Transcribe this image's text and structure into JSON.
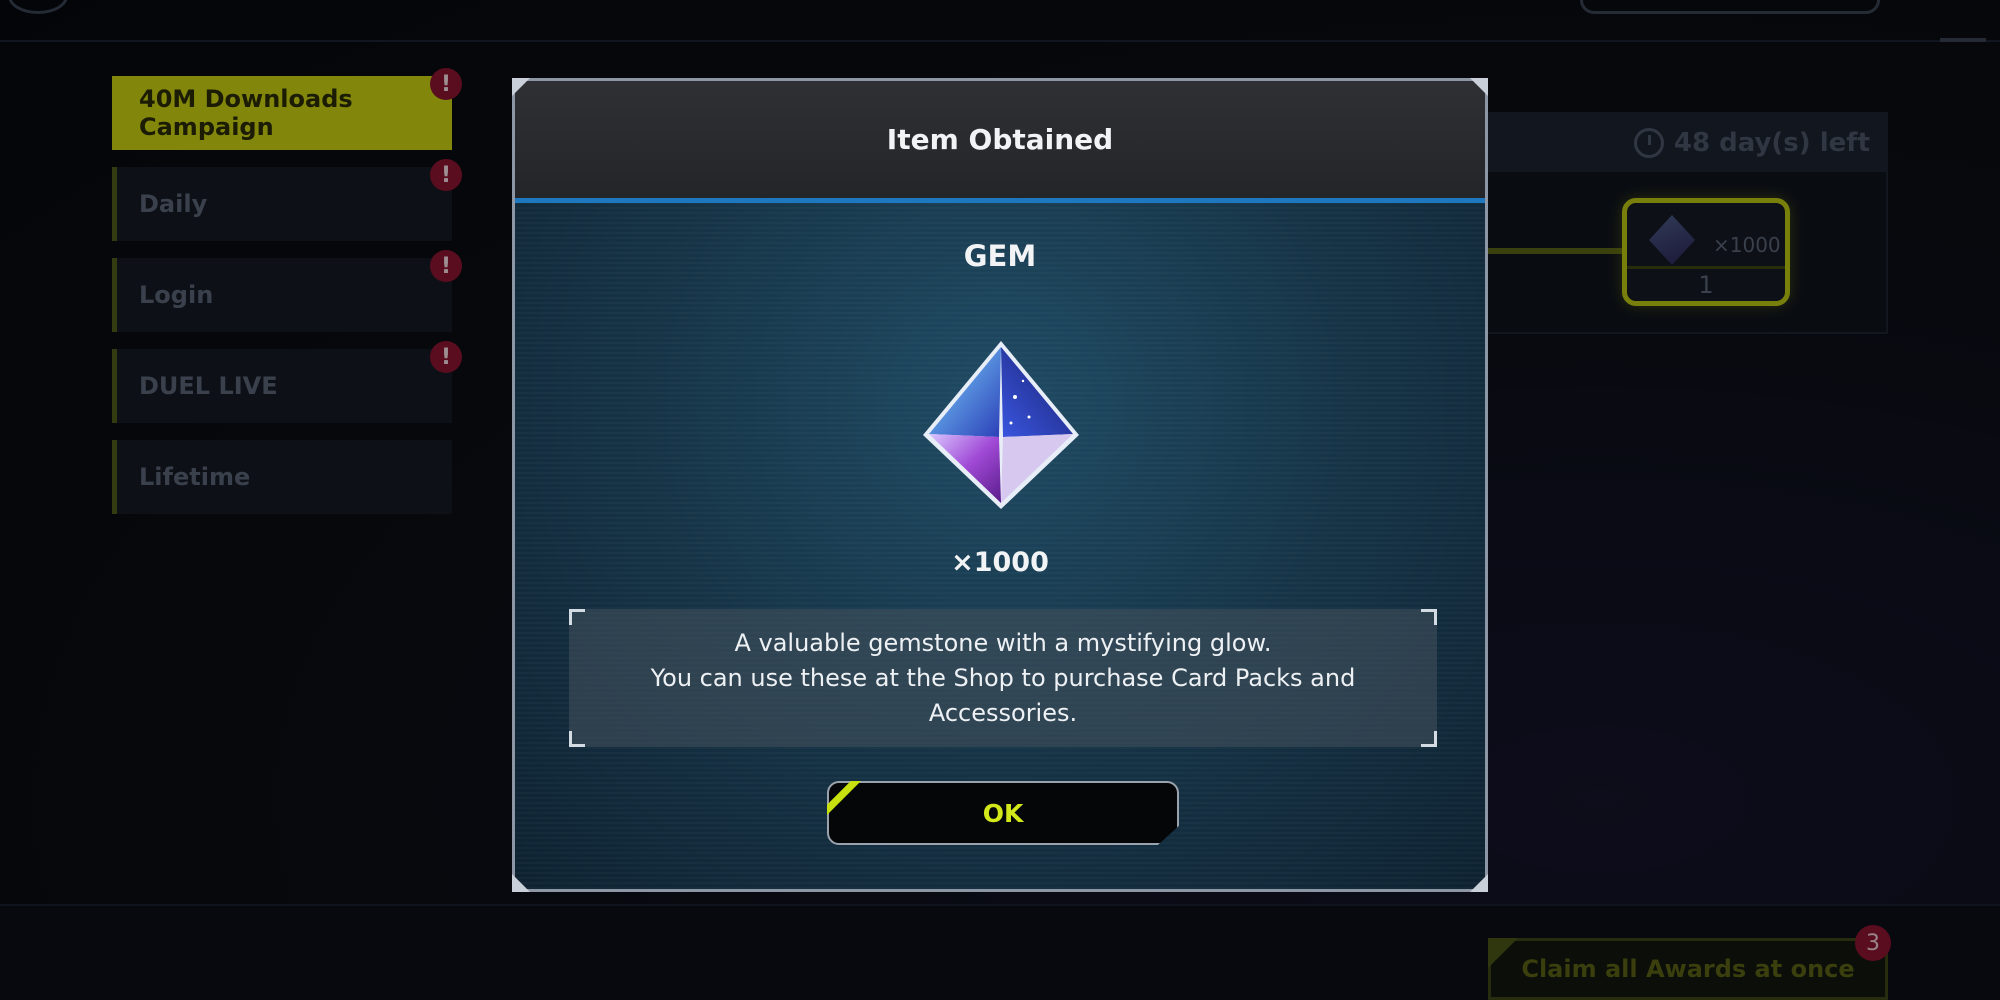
{
  "sidebar": {
    "items": [
      {
        "label": "40M Downloads Campaign",
        "alert": "!"
      },
      {
        "label": "Daily",
        "alert": "!"
      },
      {
        "label": "Login",
        "alert": "!"
      },
      {
        "label": "DUEL LIVE",
        "alert": "!"
      },
      {
        "label": "Lifetime"
      }
    ]
  },
  "campaign": {
    "days_left": "48 day(s) left",
    "reward_qty": "×1000",
    "reward_count": "1"
  },
  "claim": {
    "label": "Claim all Awards at once",
    "badge": "3"
  },
  "modal": {
    "title": "Item Obtained",
    "item_name": "GEM",
    "item_icon": "gem-icon",
    "quantity": "×1000",
    "description": {
      "line1": "A valuable gemstone with a mystifying glow.",
      "line2": "You can use these at the Shop to purchase Card Packs and",
      "line3": "Accessories."
    },
    "ok_label": "OK"
  },
  "colors": {
    "accent": "#c8e010",
    "modal_rule": "#1e78c0",
    "alert": "#8a1530"
  }
}
